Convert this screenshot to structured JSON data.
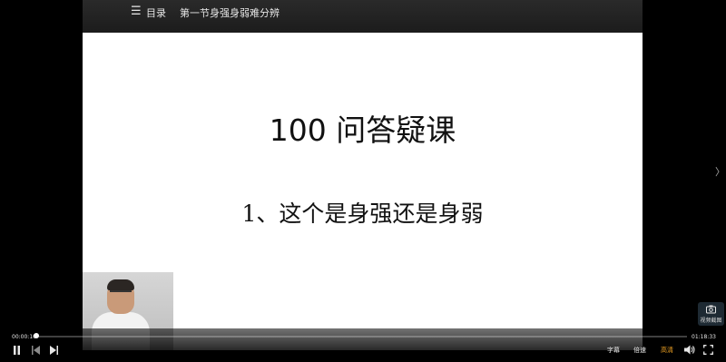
{
  "header": {
    "toc_label": "目录",
    "chapter_title": "第一节身强身弱难分辨"
  },
  "slide": {
    "title": "100 问答疑课",
    "question": "1、这个是身强还是身弱"
  },
  "player": {
    "current_time": "00:00:10",
    "total_time": "01:18:33",
    "progress_fraction": 0.002,
    "subtitle_label": "字幕",
    "speed_label": "倍速",
    "quality_label": "高清",
    "screenshot_label": "视频截图",
    "quality_color": "#f5a623"
  },
  "icons": {
    "menu": "menu-icon",
    "play_pause": "pause-icon",
    "previous": "previous-icon",
    "next": "next-icon",
    "volume": "volume-icon",
    "fullscreen": "fullscreen-icon",
    "side_arrow": "chevron-right-icon",
    "camera": "camera-icon"
  }
}
